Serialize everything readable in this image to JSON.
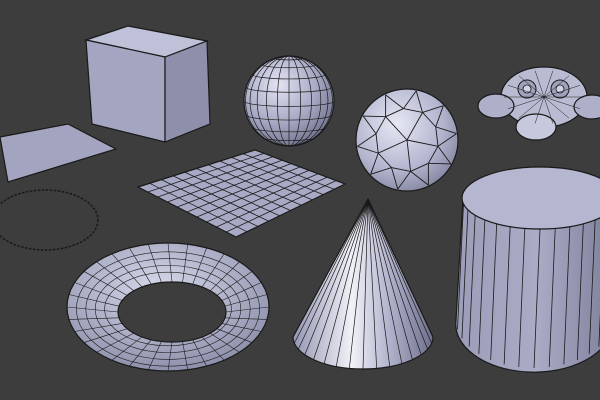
{
  "viewport": {
    "background_color": "#3d3d3d",
    "mesh_face_color": "#a7a9c4",
    "mesh_light_color": "#c4c6de",
    "mesh_dark_color": "#8587a3",
    "wire_color": "#1a1a1a"
  },
  "objects": [
    {
      "id": "cube",
      "icon": "cube-mesh-icon"
    },
    {
      "id": "uv-sphere",
      "icon": "uv-sphere-mesh-icon"
    },
    {
      "id": "icosphere",
      "icon": "icosphere-mesh-icon"
    },
    {
      "id": "monkey",
      "icon": "monkey-mesh-icon"
    },
    {
      "id": "plane",
      "icon": "plane-mesh-icon"
    },
    {
      "id": "grid",
      "icon": "grid-mesh-icon"
    },
    {
      "id": "circle",
      "icon": "circle-mesh-icon"
    },
    {
      "id": "torus",
      "icon": "torus-mesh-icon"
    },
    {
      "id": "cone",
      "icon": "cone-mesh-icon"
    },
    {
      "id": "cylinder",
      "icon": "cylinder-mesh-icon"
    }
  ]
}
